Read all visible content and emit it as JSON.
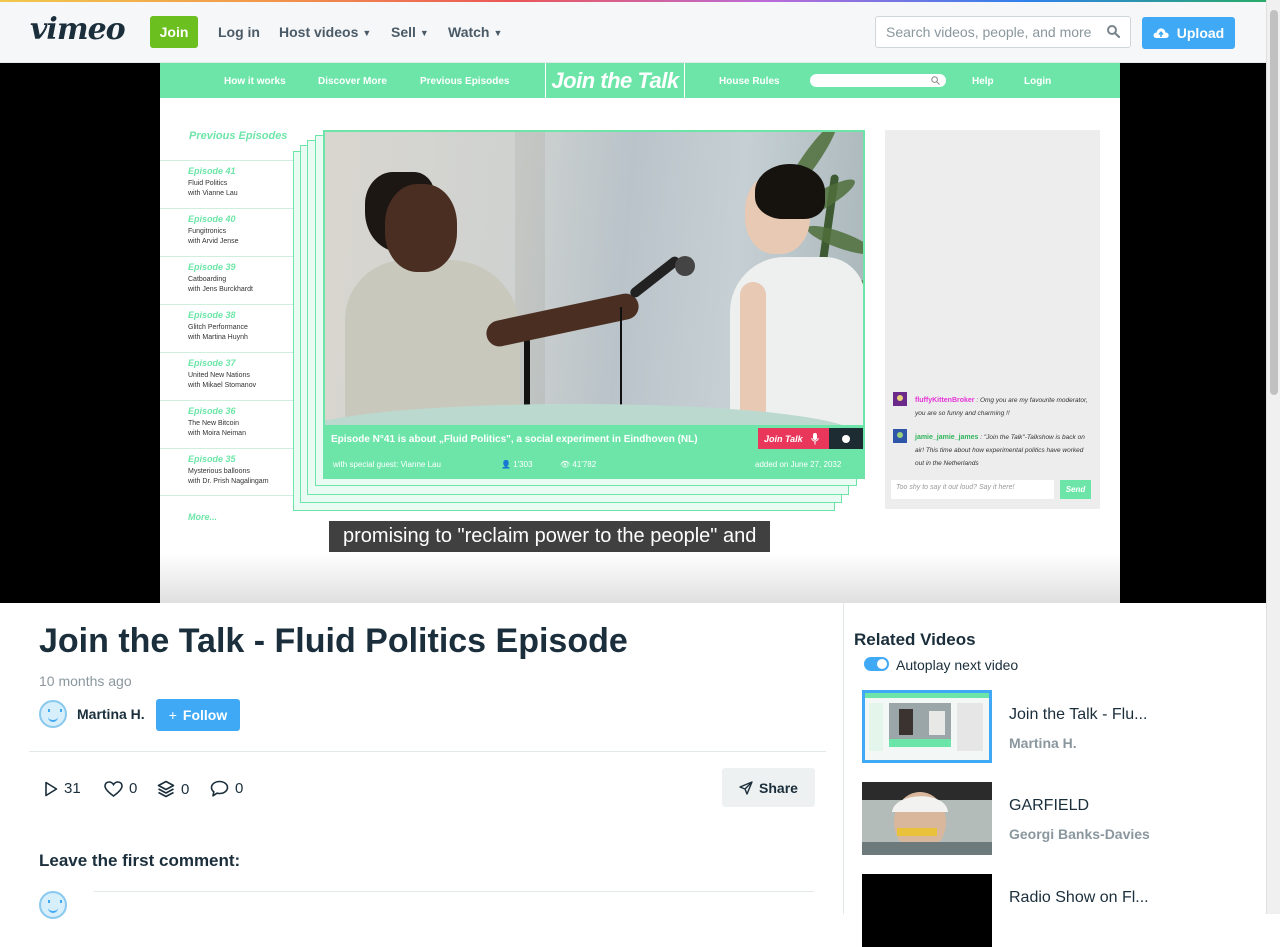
{
  "header": {
    "logo": "vimeo",
    "join_label": "Join",
    "login_label": "Log in",
    "nav": [
      {
        "label": "Host videos"
      },
      {
        "label": "Sell"
      },
      {
        "label": "Watch"
      }
    ],
    "search_placeholder": "Search videos, people, and more",
    "upload_label": "Upload"
  },
  "video": {
    "site_nav": {
      "links": [
        "How it works",
        "Discover More",
        "Previous Episodes",
        "House Rules",
        "Help",
        "Login"
      ],
      "logo": "Join the Talk"
    },
    "episodes_heading": "Previous Episodes",
    "episodes": [
      {
        "title": "Episode 41",
        "topic": "Fluid Politics",
        "guest": "with Vianne Lau"
      },
      {
        "title": "Episode 40",
        "topic": "Fungitronics",
        "guest": "with Arvid Jense"
      },
      {
        "title": "Episode 39",
        "topic": "Catboarding",
        "guest": "with Jens Burckhardt"
      },
      {
        "title": "Episode 38",
        "topic": "Glitch Performance",
        "guest": "with Martina Huynh"
      },
      {
        "title": "Episode 37",
        "topic": "United New Nations",
        "guest": "with Mikael Stomanov"
      },
      {
        "title": "Episode 36",
        "topic": "The New Bitcoin",
        "guest": "with Moira Neiman"
      },
      {
        "title": "Episode 35",
        "topic": "Mysterious balloons",
        "guest": "with Dr. Prish Nagalingam"
      }
    ],
    "more_label": "More...",
    "caption": "Episode N°41 is about „Fluid Politics\", a social experiment in Eindhoven (NL)",
    "special_guest": "with special guest: Vianne Lau",
    "people_count": "1'303",
    "views_count": "41'782",
    "added_on": "added on June 27, 2032",
    "join_talk_label": "Join Talk",
    "subtitle": "promising to \"reclaim power to the people\" and",
    "chat": {
      "messages": [
        {
          "user": "fluffyKittenBroker",
          "text": "Omg you are my favourite moderator, you are so funny and charming !!",
          "color": "#e533d6",
          "avatar_color": "#6b2a8a"
        },
        {
          "user": "jamie_jamie_james",
          "text": "\"Join the Talk\"-Talkshow is back on air! This time about how experimental politics have worked out in the Netherlands",
          "color": "#2fb45a",
          "avatar_color": "#2f55a8"
        }
      ],
      "input_placeholder": "Too shy to say it out loud? Say it here!",
      "send_label": "Send"
    }
  },
  "details": {
    "title": "Join the Talk - Fluid Politics Episode",
    "time_ago": "10 months ago",
    "author": "Martina H.",
    "follow_label": "Follow",
    "stats": {
      "plays": "31",
      "likes": "0",
      "collections": "0",
      "comments": "0"
    },
    "share_label": "Share",
    "comment_heading": "Leave the first comment:"
  },
  "related": {
    "heading": "Related Videos",
    "autoplay_label": "Autoplay next video",
    "autoplay_on": true,
    "items": [
      {
        "title": "Join the Talk - Flu...",
        "author": "Martina H."
      },
      {
        "title": "GARFIELD",
        "author": "Georgi Banks-Davies"
      },
      {
        "title": "Radio Show on Fl...",
        "author": ""
      }
    ]
  },
  "colors": {
    "accent": "#3fa9f5",
    "join_green": "#6bbf1e",
    "show_green": "#6de5a9",
    "join_talk_red": "#e8375a"
  }
}
